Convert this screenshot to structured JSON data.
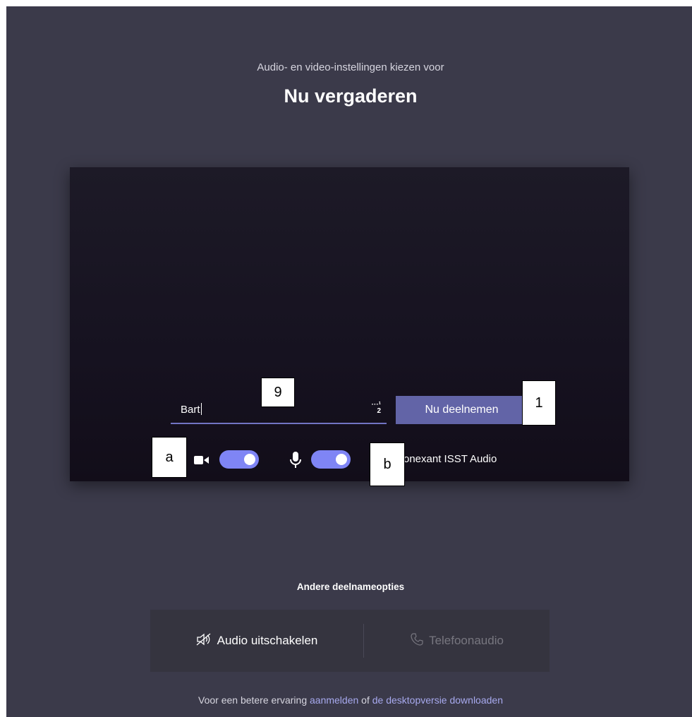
{
  "header": {
    "subtitle": "Audio- en video-instellingen kiezen voor",
    "title": "Nu vergaderen"
  },
  "join": {
    "name_value": "Bart",
    "name_icon_text": "2",
    "join_button_label": "Nu deelnemen",
    "camera_toggle_on": true,
    "mic_toggle_on": true,
    "audio_device_label": "onexant ISST Audio"
  },
  "callouts": {
    "name": "9",
    "join": "1",
    "camera": "a",
    "device": "b"
  },
  "other_options": {
    "heading": "Andere deelnameopties",
    "audio_off_label": "Audio uitschakelen",
    "phone_audio_label": "Telefoonaudio"
  },
  "footer": {
    "prefix": "Voor een betere ervaring ",
    "signin_link": "aanmelden",
    "middle": " of ",
    "download_link": "de desktopversie downloaden"
  },
  "colors": {
    "background": "#3b3a4a",
    "accent": "#6264a7",
    "toggle": "#7f85f5",
    "link": "#a7a9ee"
  }
}
